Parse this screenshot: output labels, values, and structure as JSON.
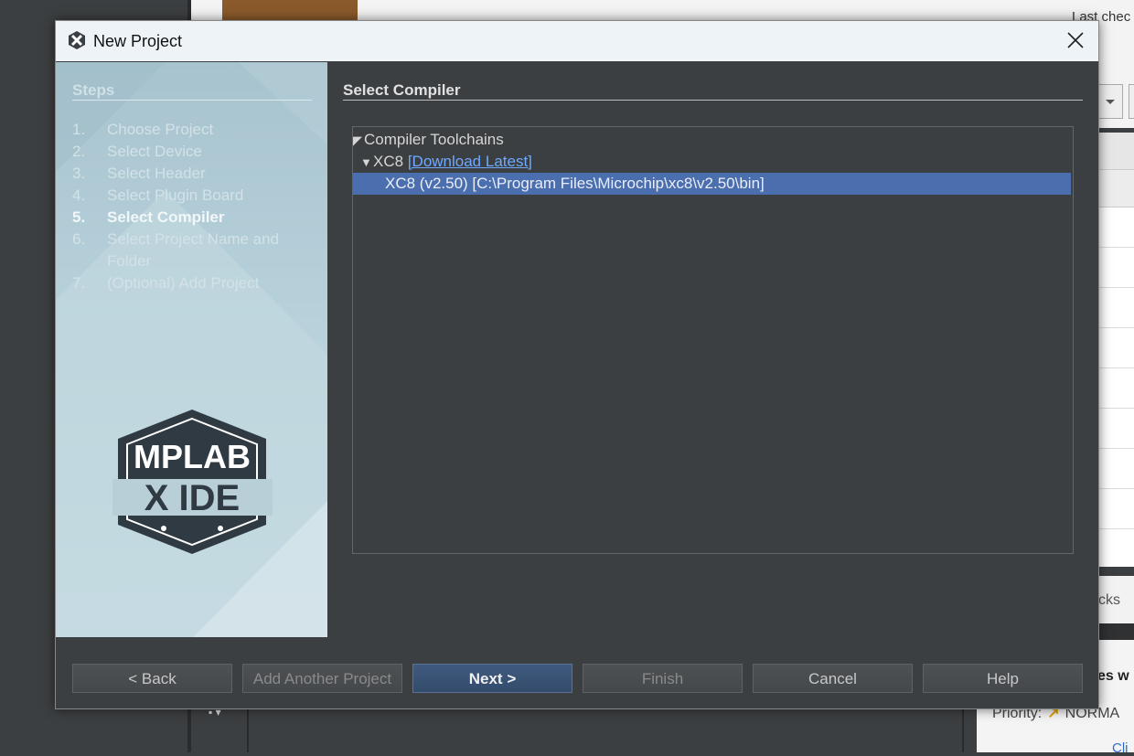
{
  "background": {
    "last_checked": "Last chec",
    "stacks": "cks",
    "bold_fragment": "es w",
    "priority_label": "Priority:",
    "priority_value": "NORMA",
    "link_fragment": "Cli"
  },
  "dialog": {
    "title": "New Project",
    "steps_title": "Steps",
    "steps": [
      {
        "num": "1.",
        "label": "Choose Project"
      },
      {
        "num": "2.",
        "label": "Select Device"
      },
      {
        "num": "3.",
        "label": "Select Header"
      },
      {
        "num": "4.",
        "label": "Select Plugin Board"
      },
      {
        "num": "5.",
        "label": "Select Compiler"
      },
      {
        "num": "6.",
        "label": "Select Project Name and"
      },
      {
        "num": "",
        "label": "Folder"
      },
      {
        "num": "7.",
        "label": "(Optional) Add Project"
      }
    ],
    "active_step": "5",
    "logo_line1": "MPLAB",
    "logo_line2": "X IDE",
    "content_title": "Select Compiler",
    "tree": {
      "root": "Compiler Toolchains",
      "group": "XC8",
      "download_link": "[Download Latest]",
      "selected_item": "XC8 (v2.50) [C:\\Program Files\\Microchip\\xc8\\v2.50\\bin]"
    },
    "buttons": {
      "back": "< Back",
      "add_another": "Add Another Project",
      "next": "Next >",
      "finish": "Finish",
      "cancel": "Cancel",
      "help": "Help"
    }
  },
  "colors": {
    "selection": "#4b6eaf",
    "link": "#6ea9ff",
    "primary_button": "#3f5a7e"
  }
}
